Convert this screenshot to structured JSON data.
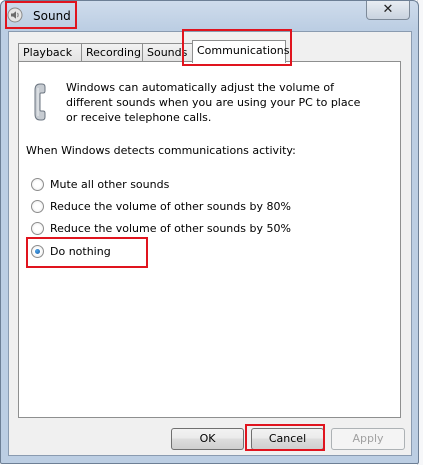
{
  "window": {
    "title": "Sound",
    "close_glyph": "✕"
  },
  "tabs": [
    {
      "label": "Playback"
    },
    {
      "label": "Recording"
    },
    {
      "label": "Sounds"
    },
    {
      "label": "Communications",
      "active": true
    }
  ],
  "communications": {
    "description": "Windows can automatically adjust the volume of different sounds when you are using your PC to place or receive telephone calls.",
    "section_label": "When Windows detects communications activity:",
    "options": [
      {
        "label": "Mute all other sounds",
        "checked": false
      },
      {
        "label": "Reduce the volume of other sounds by 80%",
        "checked": false
      },
      {
        "label": "Reduce the volume of other sounds by 50%",
        "checked": false
      },
      {
        "label": "Do nothing",
        "checked": true
      }
    ]
  },
  "buttons": {
    "ok": "OK",
    "cancel": "Cancel",
    "apply": "Apply"
  },
  "icons": {
    "app": "speaker-icon",
    "phone": "telephone-icon"
  },
  "colors": {
    "annotation": "#e0141e",
    "radio_selected": "#1d5fa8"
  }
}
